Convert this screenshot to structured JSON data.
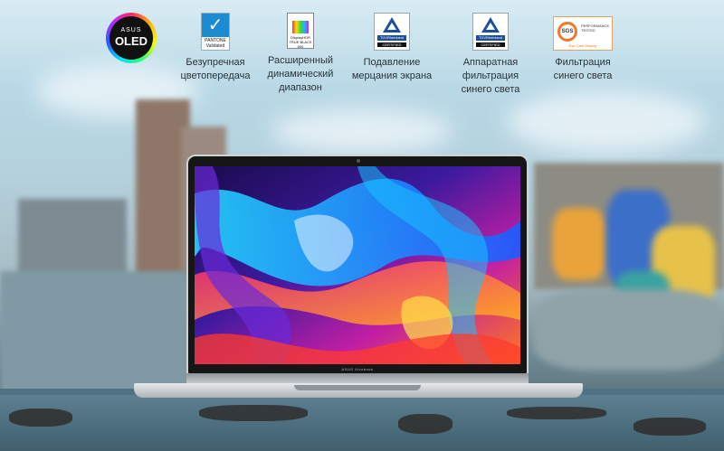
{
  "features": [
    {
      "id": "oled",
      "label": "",
      "badge": {
        "brand": "ASUS",
        "text": "OLED"
      }
    },
    {
      "id": "pantone",
      "label": "Безупречная цветопередача",
      "badge": {
        "brand": "PANTONE",
        "sub": "Validated"
      }
    },
    {
      "id": "dhdr",
      "label": "Расширенный динамический диапазон",
      "badge": {
        "text": "DisplayHDR",
        "sub": "TRUE BLACK 600"
      }
    },
    {
      "id": "tuv-flicker",
      "label": "Подавление мерцания экрана",
      "badge": {
        "brand": "TÜVRheinland",
        "sub": "CERTIFIED"
      }
    },
    {
      "id": "tuv-bluelight",
      "label": "Аппаратная фильтрация синего света",
      "badge": {
        "brand": "TÜVRheinland",
        "sub": "CERTIFIED"
      }
    },
    {
      "id": "sgs",
      "label": "Фильтрация синего света",
      "badge": {
        "brand": "SGS",
        "line1": "PERFORMANCE",
        "line2": "TESTED",
        "foot": "Eye Care Display"
      }
    }
  ],
  "laptop": {
    "brand": "ASUS Vivobook"
  },
  "colors": {
    "text": "#2a3238",
    "bezel": "#161616",
    "accent_tuv": "#1a4f9c",
    "pantone": "#1c8bd1",
    "sgs": "#f07a2a"
  },
  "icons": [
    "oled-badge-icon",
    "pantone-validated-icon",
    "displayhdr-icon",
    "tuv-flicker-free-icon",
    "tuv-low-blue-light-icon",
    "sgs-eye-care-icon"
  ]
}
